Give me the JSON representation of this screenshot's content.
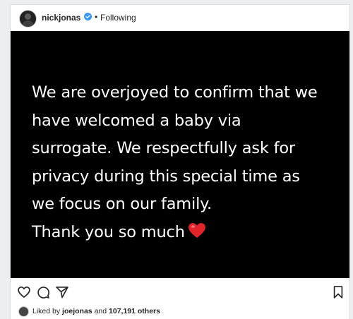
{
  "post": {
    "author": {
      "username": "nickjonas",
      "verified": true,
      "follow_status": "Following",
      "separator": "•"
    },
    "message": {
      "lines": [
        "We are overjoyed to confirm that we",
        "have welcomed a baby via",
        "surrogate. We respectfully ask for",
        "privacy during this special time as",
        "we focus on our family.",
        "Thank you so much"
      ],
      "emoji": "heart"
    },
    "actions": {
      "like_icon": "heart-outline-icon",
      "comment_icon": "comment-icon",
      "share_icon": "send-icon",
      "save_icon": "bookmark-icon"
    },
    "likes": {
      "prefix": "Liked by",
      "user": "joejonas",
      "connector": "and",
      "others": "107,191 others"
    }
  },
  "colors": {
    "verified_badge": "#3897f0",
    "heart_emoji": "#e0242a",
    "media_background": "#000000",
    "text_primary": "#262626"
  }
}
